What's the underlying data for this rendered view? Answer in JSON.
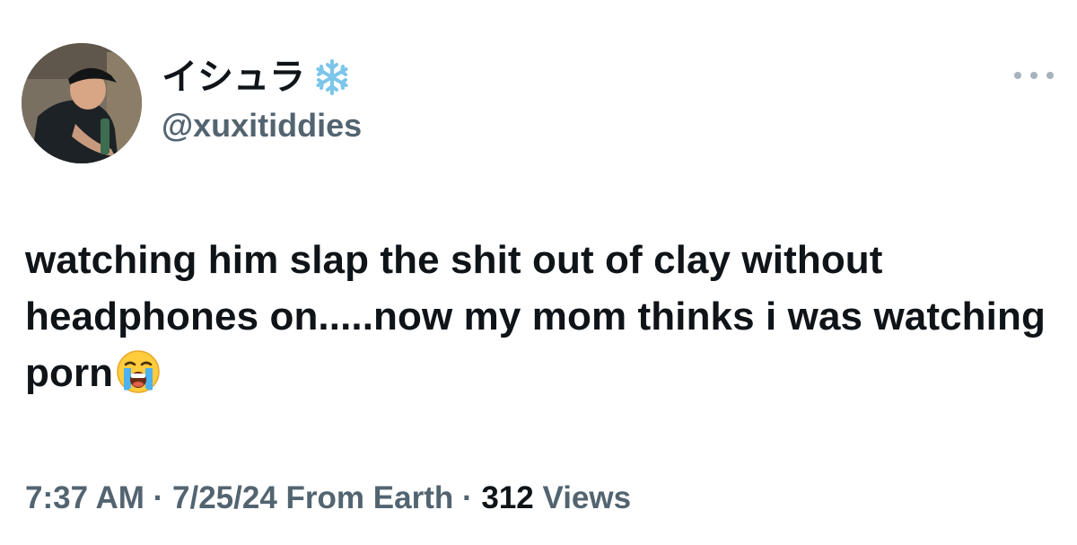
{
  "author": {
    "display_name": "イシュラ",
    "name_badge_icon": "snowflake-emoji",
    "handle": "@xuxitiddies"
  },
  "tweet": {
    "text": "watching him slap the shit out of clay without headphones on.....now my mom thinks i was watching porn",
    "trailing_emoji": "loudly-crying-face-emoji"
  },
  "meta": {
    "time": "7:37 AM",
    "sep1": " · ",
    "date": "7/25/24",
    "source": "From Earth",
    "sep2": " · ",
    "views_count": "312",
    "views_label": "Views"
  },
  "menu": {
    "icon": "more-horizontal-icon"
  },
  "colors": {
    "text_primary": "#0f1419",
    "text_secondary": "#536471",
    "background": "#ffffff"
  }
}
